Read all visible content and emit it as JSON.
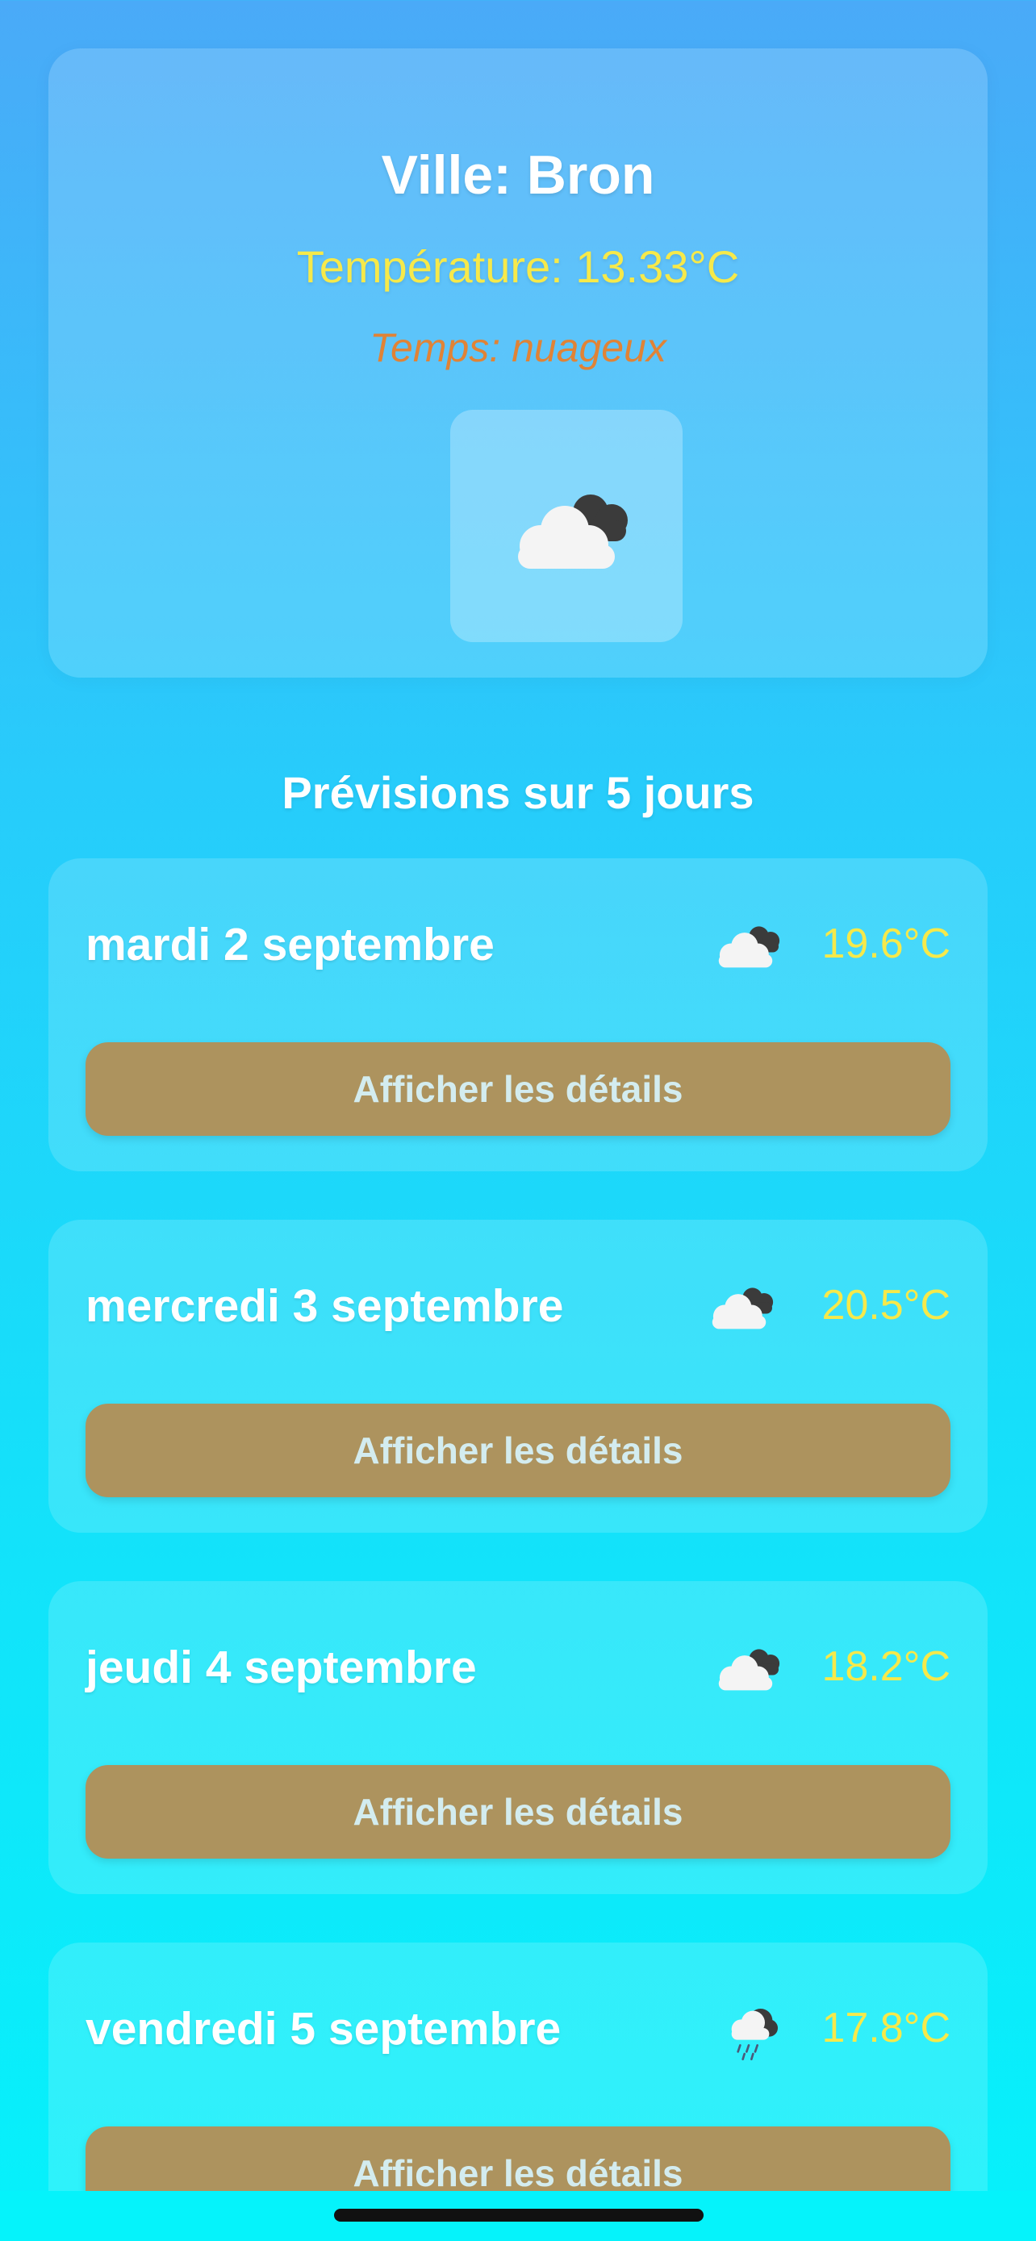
{
  "current": {
    "city": "Ville: Bron",
    "temperature": "Température: 13.33°C",
    "condition": "Temps: nuageux",
    "icon": "cloudy-icon"
  },
  "forecast": {
    "title": "Prévisions sur 5 jours",
    "days": [
      {
        "name": "mardi 2 septembre",
        "temp": "19.6°C",
        "icon": "cloudy-icon",
        "button": "Afficher les détails"
      },
      {
        "name": "mercredi 3 septembre",
        "temp": "20.5°C",
        "icon": "cloudy-icon",
        "button": "Afficher les détails"
      },
      {
        "name": "jeudi 4 septembre",
        "temp": "18.2°C",
        "icon": "cloudy-icon",
        "button": "Afficher les détails"
      },
      {
        "name": "vendredi 5 septembre",
        "temp": "17.8°C",
        "icon": "rain-cloud-icon",
        "button": "Afficher les détails"
      }
    ]
  },
  "colors": {
    "temperature": "#f6e94a",
    "condition": "#e08336",
    "button": "#ad935e"
  }
}
